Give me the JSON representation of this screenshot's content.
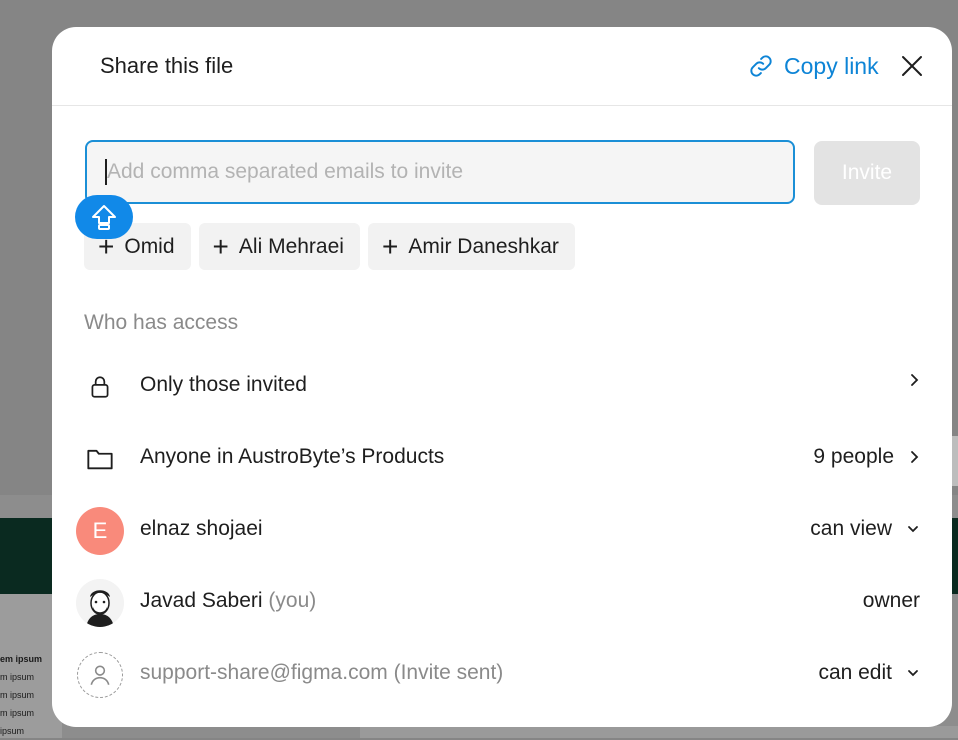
{
  "dialog": {
    "title": "Share this file",
    "copy_link_label": "Copy link"
  },
  "invite": {
    "placeholder": "Add comma separated emails to invite",
    "button_label": "Invite",
    "suggestions": [
      "Omid",
      "Ali Mehraei",
      "Amir Daneshkar"
    ]
  },
  "access": {
    "section_label": "Who has access",
    "only_invited": "Only those invited",
    "anyone_label": "Anyone in AustroByte’s Products",
    "anyone_count": "9 people"
  },
  "members": [
    {
      "avatar_letter": "E",
      "name": "elnaz shojaei",
      "suffix": "",
      "role": "can view"
    },
    {
      "avatar_letter": "",
      "name": "Javad Saberi",
      "suffix": "(you)",
      "role": "owner"
    },
    {
      "avatar_letter": "",
      "name": "support-share@figma.com (Invite sent)",
      "suffix": "",
      "role": "can edit"
    }
  ],
  "background": {
    "lines": [
      "em ipsum",
      "m ipsum",
      "m ipsum",
      "m ipsum",
      "ipsum"
    ]
  },
  "colors": {
    "accent": "#0d84d6",
    "avatar_e": "#f98a7b",
    "input_border": "#1b8fd6"
  }
}
